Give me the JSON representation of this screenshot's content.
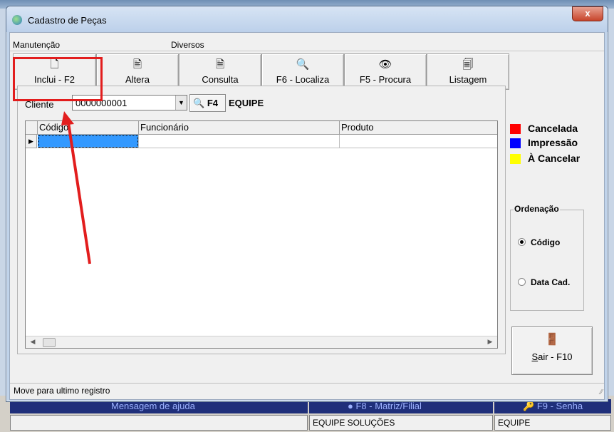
{
  "window": {
    "title": "Cadastro de Peças",
    "close_glyph": "x"
  },
  "menu": {
    "items": [
      "Manutenção",
      "Diversos"
    ]
  },
  "toolbar": {
    "buttons": [
      {
        "label": "Inclui - F2",
        "icon": "new-document-icon",
        "glyph": "🗋"
      },
      {
        "label": "Altera",
        "icon": "edit-document-icon",
        "glyph": "🖹"
      },
      {
        "label": "Consulta",
        "icon": "view-document-icon",
        "glyph": "🗎"
      },
      {
        "label": "F6 - Localiza",
        "icon": "magnifier-icon",
        "glyph": "🔍"
      },
      {
        "label": "F5 - Procura",
        "icon": "eye-search-icon",
        "glyph": "👁"
      },
      {
        "label": "Listagem",
        "icon": "list-report-icon",
        "glyph": "🗐"
      }
    ]
  },
  "filter": {
    "cliente_label": "Cliente",
    "cliente_value": "0000000001",
    "combo_arrow": "▼",
    "f4_label": "F4",
    "f4_glyph": "🔍",
    "client_name": "EQUIPE"
  },
  "grid": {
    "columns": [
      "Código",
      "Funcionário",
      "Produto"
    ],
    "row_indicator": "▶",
    "scroll_left": "◀",
    "scroll_right": "▶"
  },
  "legend": {
    "items": [
      {
        "label": "Cancelada",
        "color": "#ff0000"
      },
      {
        "label": "Impressão",
        "color": "#0000ff"
      },
      {
        "label": "À Cancelar",
        "color": "#ffff00"
      }
    ]
  },
  "ordenacao": {
    "title": "Ordenação",
    "options": [
      {
        "label": "Código",
        "selected": true
      },
      {
        "label": "Data Cad.",
        "selected": false
      }
    ]
  },
  "exit_button": {
    "underlined": "S",
    "rest": "air - F10",
    "glyph": "🚪"
  },
  "status": {
    "text": "Move para ultimo registro",
    "grip": "⁄⁄"
  },
  "background_app": {
    "help_bar": "Mensagem de ajuda",
    "matriz_bar": "F8 - Matriz/Filial",
    "senha_bar": "F9 - Senha",
    "company": "EQUIPE SOLUÇÕES",
    "user": "EQUIPE"
  },
  "colors": {
    "highlight": "#e21d1d",
    "selection": "#3399ff"
  }
}
